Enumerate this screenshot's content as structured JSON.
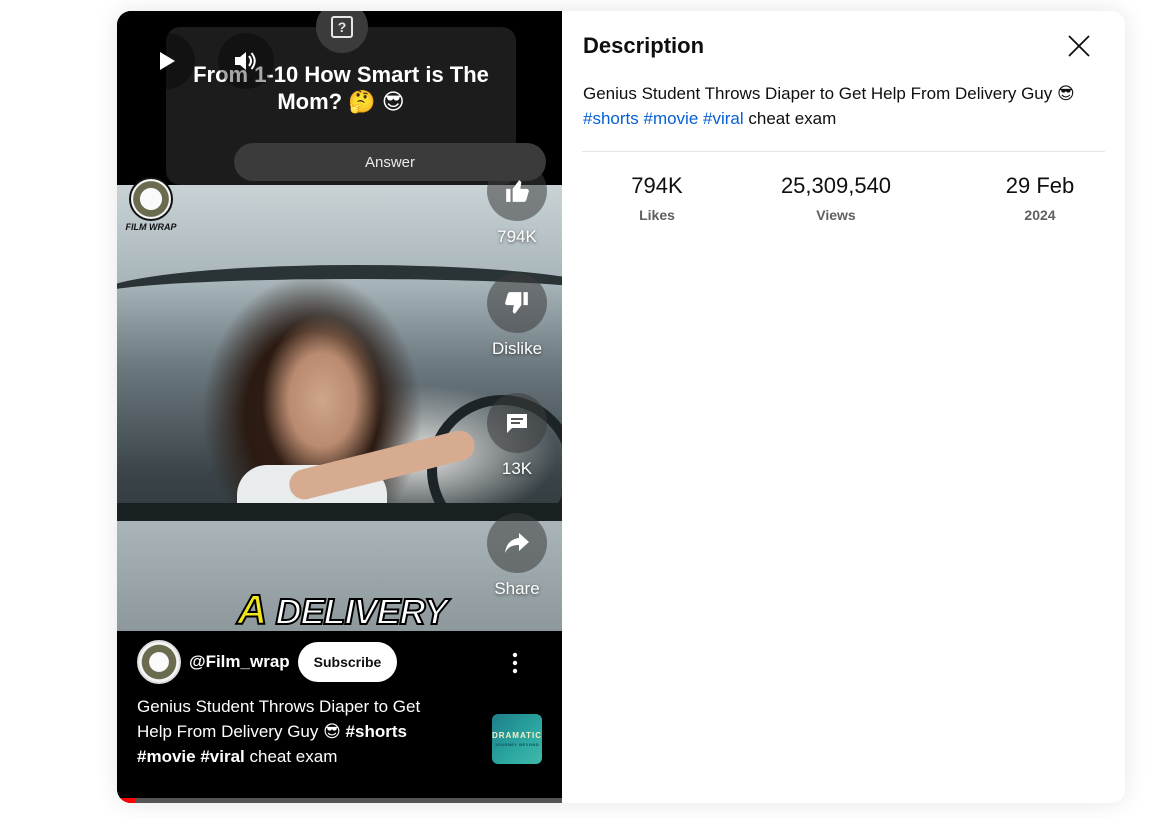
{
  "poll": {
    "question": "From 1-10 How Smart is The Mom? 🤔 😎",
    "answer_label": "Answer",
    "icon": "question-icon"
  },
  "player": {
    "logo_text": "FILM WRAP",
    "caption_a": "A",
    "caption_rest": "DELIVERY",
    "progress_fraction": 0.04
  },
  "actions": [
    {
      "icon": "thumb-up-icon",
      "label": "794K"
    },
    {
      "icon": "thumb-down-icon",
      "label": "Dislike"
    },
    {
      "icon": "comment-icon",
      "label": "13K"
    },
    {
      "icon": "share-icon",
      "label": "Share"
    }
  ],
  "channel": {
    "handle": "@Film_wrap",
    "subscribe_label": "Subscribe"
  },
  "video": {
    "title_plain": "Genius Student Throws Diaper to Get Help From Delivery Guy 😎 ",
    "tag1": "#shorts",
    "tag2": "#movie",
    "tag3": "#viral",
    "title_tail": " cheat exam",
    "playlist_thumb_title": "DRAMATIC",
    "playlist_thumb_sub": "JOURNEY BEYOND"
  },
  "description": {
    "heading": "Description",
    "text": "Genius Student Throws Diaper to Get Help From Delivery Guy 😎",
    "tag1": "#shorts",
    "tag2": "#movie",
    "tag3": "#viral",
    "tail": " cheat exam"
  },
  "stats": [
    {
      "value": "794K",
      "label": "Likes"
    },
    {
      "value": "25,309,540",
      "label": "Views"
    },
    {
      "value": "29 Feb",
      "label": "2024"
    }
  ]
}
